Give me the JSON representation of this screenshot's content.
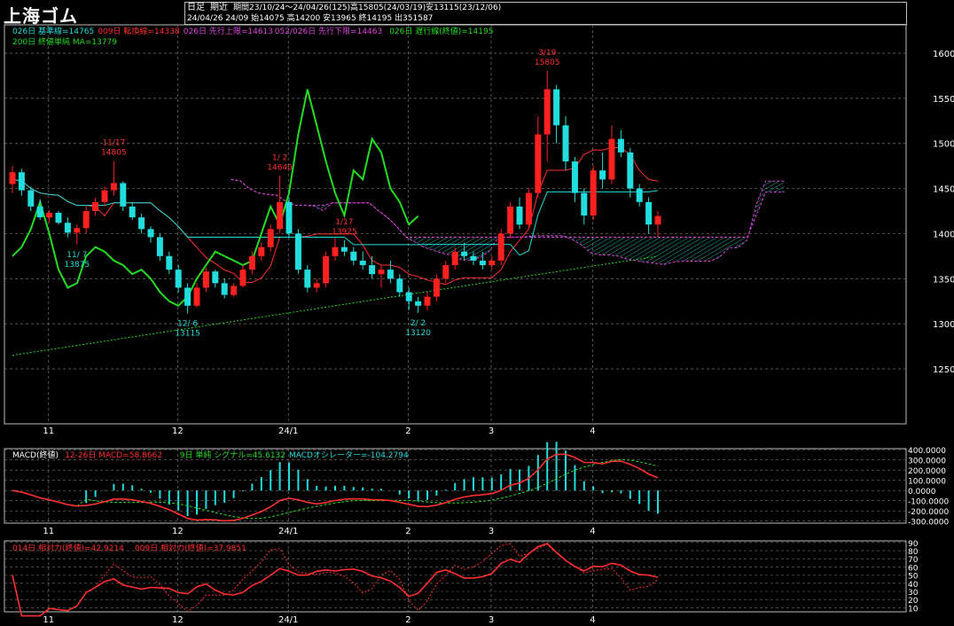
{
  "title": "上海ゴム",
  "info": {
    "kind": "日足",
    "contract": "期近",
    "range_line": "期間23/10/24～24/04/26(125)高15805(24/03/19)安13115(23/12/06)",
    "day_line": "24/04/26 24/09 始14075 高14200 安13965 終14195 出351587"
  },
  "main_legend": [
    {
      "text": "026日 基準線=14765",
      "color": "#22dddd"
    },
    {
      "text": "009日 転換線=14338",
      "color": "#ff3030"
    },
    {
      "text": "026日 先行上限=14613",
      "color": "#dd44dd"
    },
    {
      "text": "052/026日 先行下限=14463",
      "color": "#dd44dd"
    },
    {
      "text": "026日 遅行線(終値)=14195",
      "color": "#22dd22"
    },
    {
      "text": "200日 終値単純 MA=13779",
      "color": "#22dd22"
    }
  ],
  "macd_legend": [
    {
      "text": "MACD(終値)",
      "color": "#ffffff"
    },
    {
      "text": "12-26日 MACD=58.8662",
      "color": "#ff3030"
    },
    {
      "text": "9日 単純 シグナル=45.6132",
      "color": "#22dd22"
    },
    {
      "text": "MACDオシレーター=-104.2794",
      "color": "#22dddd"
    }
  ],
  "rsi_legend": [
    {
      "text": "014日 相対力(終値)=42.9214",
      "color": "#ff3030"
    },
    {
      "text": "009日 相対力(終値)=37.9851",
      "color": "#ff3030"
    }
  ],
  "x_ticks": [
    "11",
    "12",
    "24/1",
    "2",
    "3",
    "4"
  ],
  "price_ticks": [
    "16000",
    "15500",
    "15000",
    "14500",
    "14000",
    "13500",
    "13000",
    "12500"
  ],
  "macd_ticks": [
    "400.0000",
    "300.0000",
    "200.0000",
    "100.0000",
    "0.0000",
    "-100.0000",
    "-200.0000",
    "-300.0000"
  ],
  "rsi_ticks": [
    "90",
    "80",
    "70",
    "60",
    "50",
    "40",
    "30",
    "20",
    "10"
  ],
  "annotations": [
    {
      "date": "11/17",
      "value": "14805",
      "color": "#ff3030"
    },
    {
      "date": "1/ 2",
      "value": "14640",
      "color": "#ff3030"
    },
    {
      "date": "1/17",
      "value": "13925",
      "color": "#ff3030"
    },
    {
      "date": "11/ 7",
      "value": "13875",
      "color": "#22dddd"
    },
    {
      "date": "12/ 6",
      "value": "13115",
      "color": "#22dddd"
    },
    {
      "date": "2/ 2",
      "value": "13120",
      "color": "#22dddd"
    },
    {
      "date": "3/19",
      "value": "15805",
      "color": "#ff3030"
    }
  ],
  "chart_data": {
    "type": "candlestick",
    "price_range": [
      12500,
      16100
    ],
    "macd_range": [
      -320,
      410
    ],
    "rsi_range": [
      5,
      92
    ],
    "ohlc": [
      [
        14550,
        14750,
        14450,
        14680
      ],
      [
        14680,
        14720,
        14420,
        14480
      ],
      [
        14480,
        14520,
        14250,
        14300
      ],
      [
        14300,
        14380,
        14150,
        14180
      ],
      [
        14180,
        14260,
        14120,
        14230
      ],
      [
        14230,
        14250,
        14100,
        14120
      ],
      [
        14120,
        14180,
        13960,
        14010
      ],
      [
        14010,
        14100,
        13875,
        14060
      ],
      [
        14060,
        14300,
        14000,
        14250
      ],
      [
        14250,
        14400,
        14200,
        14350
      ],
      [
        14350,
        14520,
        14300,
        14480
      ],
      [
        14480,
        14805,
        14420,
        14560
      ],
      [
        14560,
        14580,
        14250,
        14300
      ],
      [
        14300,
        14350,
        14150,
        14180
      ],
      [
        14180,
        14220,
        14000,
        14050
      ],
      [
        14050,
        14080,
        13900,
        13960
      ],
      [
        13960,
        14000,
        13700,
        13750
      ],
      [
        13750,
        13800,
        13550,
        13600
      ],
      [
        13600,
        13650,
        13350,
        13400
      ],
      [
        13400,
        13450,
        13115,
        13200
      ],
      [
        13200,
        13450,
        13180,
        13400
      ],
      [
        13400,
        13620,
        13350,
        13580
      ],
      [
        13580,
        13600,
        13400,
        13450
      ],
      [
        13450,
        13500,
        13280,
        13320
      ],
      [
        13320,
        13450,
        13300,
        13420
      ],
      [
        13420,
        13650,
        13400,
        13600
      ],
      [
        13600,
        13800,
        13550,
        13750
      ],
      [
        13750,
        13900,
        13700,
        13850
      ],
      [
        13850,
        14100,
        13800,
        14050
      ],
      [
        14050,
        14640,
        14000,
        14350
      ],
      [
        14350,
        14400,
        13950,
        14000
      ],
      [
        14000,
        14050,
        13550,
        13600
      ],
      [
        13600,
        13650,
        13350,
        13400
      ],
      [
        13400,
        13500,
        13350,
        13450
      ],
      [
        13450,
        13800,
        13400,
        13750
      ],
      [
        13750,
        13950,
        13700,
        13850
      ],
      [
        13850,
        13925,
        13750,
        13800
      ],
      [
        13800,
        13850,
        13650,
        13700
      ],
      [
        13700,
        13800,
        13600,
        13650
      ],
      [
        13650,
        13750,
        13500,
        13550
      ],
      [
        13550,
        13650,
        13400,
        13600
      ],
      [
        13600,
        13700,
        13450,
        13500
      ],
      [
        13500,
        13550,
        13300,
        13350
      ],
      [
        13350,
        13400,
        13150,
        13250
      ],
      [
        13250,
        13300,
        13120,
        13200
      ],
      [
        13200,
        13350,
        13150,
        13300
      ],
      [
        13300,
        13550,
        13250,
        13500
      ],
      [
        13500,
        13700,
        13450,
        13650
      ],
      [
        13650,
        13850,
        13600,
        13800
      ],
      [
        13800,
        13900,
        13700,
        13750
      ],
      [
        13750,
        13800,
        13650,
        13700
      ],
      [
        13700,
        13800,
        13600,
        13650
      ],
      [
        13650,
        13750,
        13600,
        13700
      ],
      [
        13700,
        14050,
        13650,
        14000
      ],
      [
        14000,
        14350,
        13950,
        14300
      ],
      [
        14300,
        14400,
        14050,
        14100
      ],
      [
        14100,
        14500,
        14050,
        14450
      ],
      [
        14450,
        15300,
        14400,
        15100
      ],
      [
        15100,
        15805,
        14800,
        15600
      ],
      [
        15600,
        15650,
        15000,
        15200
      ],
      [
        15200,
        15300,
        14700,
        14800
      ],
      [
        14800,
        14850,
        14350,
        14450
      ],
      [
        14450,
        14500,
        14100,
        14200
      ],
      [
        14200,
        14750,
        14150,
        14700
      ],
      [
        14700,
        14900,
        14500,
        14600
      ],
      [
        14600,
        15200,
        14550,
        15050
      ],
      [
        15050,
        15150,
        14850,
        14900
      ],
      [
        14900,
        14950,
        14400,
        14500
      ],
      [
        14500,
        14550,
        14300,
        14350
      ],
      [
        14350,
        14400,
        14000,
        14100
      ],
      [
        14100,
        14250,
        13965,
        14195
      ]
    ]
  }
}
